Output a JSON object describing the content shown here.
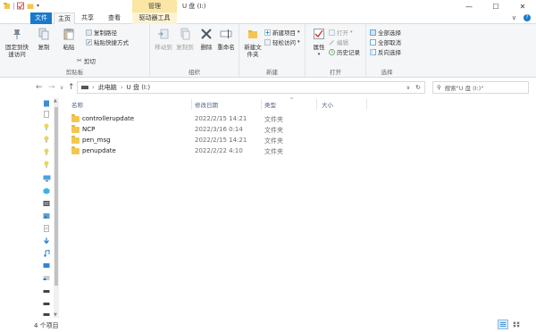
{
  "titlebar": {
    "manage_tab": "管理",
    "window_title": "U 盘 (I:)",
    "controls": {
      "minimize": "—",
      "maximize": "☐",
      "close": "✕"
    }
  },
  "tabs": {
    "file": "文件",
    "home": "主页",
    "share": "共享",
    "view": "查看",
    "drive_tools": "驱动器工具",
    "expand": "∨"
  },
  "ribbon": {
    "clipboard": {
      "label": "剪贴板",
      "pin": "固定到快速访问",
      "copy": "复制",
      "paste": "粘贴",
      "copy_path": "复制路径",
      "paste_shortcut": "粘贴快捷方式",
      "cut": "剪切"
    },
    "organize": {
      "label": "组织",
      "move_to": "移动到",
      "copy_to": "复制到",
      "delete": "删除",
      "rename": "重命名"
    },
    "new": {
      "label": "新建",
      "new_folder": "新建文件夹",
      "new_item": "新建项目",
      "easy_access": "轻松访问"
    },
    "open": {
      "label": "打开",
      "properties": "属性",
      "open": "打开",
      "edit": "编辑",
      "history": "历史记录"
    },
    "select": {
      "label": "选择",
      "select_all": "全部选择",
      "select_none": "全部取消",
      "invert": "反向选择"
    }
  },
  "address": {
    "path_pc": "此电脑",
    "path_drive": "U 盘 (I:)",
    "search_placeholder": "搜索\"U 盘 (I:)\""
  },
  "columns": {
    "name": "名称",
    "date": "修改日期",
    "type": "类型",
    "size": "大小"
  },
  "files": [
    {
      "name": "controllerupdate",
      "date": "2022/2/15 14:21",
      "type": "文件夹"
    },
    {
      "name": "NCP",
      "date": "2022/3/16 0:14",
      "type": "文件夹"
    },
    {
      "name": "pen_msg",
      "date": "2022/2/15 14:21",
      "type": "文件夹"
    },
    {
      "name": "penupdate",
      "date": "2022/2/22 4:10",
      "type": "文件夹"
    }
  ],
  "status": {
    "item_count": "4 个项目"
  },
  "colors": {
    "accent": "#1979ca",
    "folder": "#f3c74f",
    "manage": "#fbe6a4"
  }
}
